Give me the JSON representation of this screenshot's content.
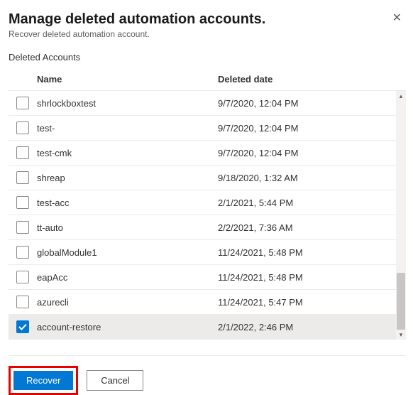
{
  "header": {
    "title": "Manage deleted automation accounts.",
    "subtitle": "Recover deleted automation account."
  },
  "section_label": "Deleted Accounts",
  "columns": {
    "name": "Name",
    "date": "Deleted date"
  },
  "rows": [
    {
      "name": "shrlockboxtest",
      "date": "9/7/2020, 12:04 PM",
      "checked": false
    },
    {
      "name": "test-",
      "date": "9/7/2020, 12:04 PM",
      "checked": false
    },
    {
      "name": "test-cmk",
      "date": "9/7/2020, 12:04 PM",
      "checked": false
    },
    {
      "name": "shreap",
      "date": "9/18/2020, 1:32 AM",
      "checked": false
    },
    {
      "name": "test-acc",
      "date": "2/1/2021, 5:44 PM",
      "checked": false
    },
    {
      "name": "tt-auto",
      "date": "2/2/2021, 7:36 AM",
      "checked": false
    },
    {
      "name": "globalModule1",
      "date": "11/24/2021, 5:48 PM",
      "checked": false
    },
    {
      "name": "eapAcc",
      "date": "11/24/2021, 5:48 PM",
      "checked": false
    },
    {
      "name": "azurecli",
      "date": "11/24/2021, 5:47 PM",
      "checked": false
    },
    {
      "name": "account-restore",
      "date": "2/1/2022, 2:46 PM",
      "checked": true
    }
  ],
  "footer": {
    "recover": "Recover",
    "cancel": "Cancel"
  },
  "colors": {
    "primary": "#0078d4",
    "highlight": "#e60000"
  }
}
